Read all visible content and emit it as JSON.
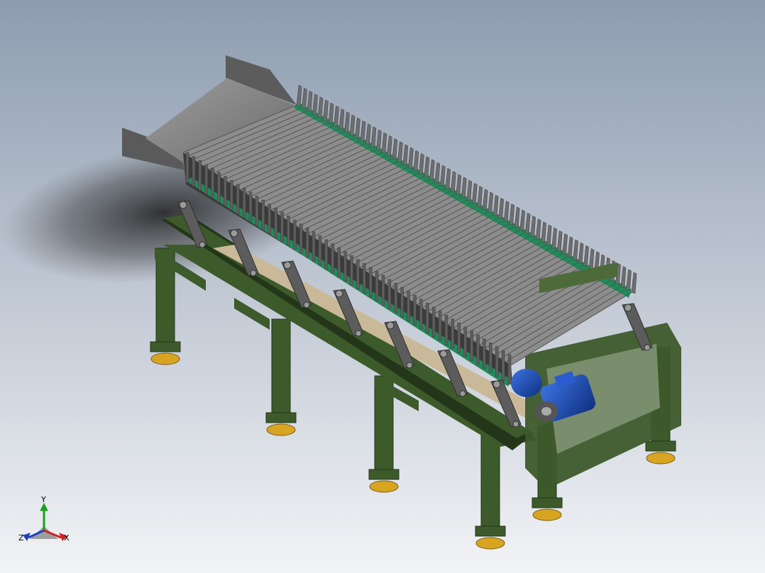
{
  "viewport": {
    "background_top": "#8d9cb0",
    "background_bottom": "#f2f3f6"
  },
  "model": {
    "frame_color": "#3d5a2b",
    "frame_dark": "#24361a",
    "chute_color": "#8a8a8a",
    "fin_color": "#6e6e6e",
    "belt_color": "#1e8c5a",
    "motor_color": "#1f4fb8",
    "foot_color": "#d9a521",
    "rail_color": "#c9b998"
  },
  "triad": {
    "x_label": "X",
    "y_label": "Y",
    "z_label": "Z",
    "x_color": "#d02020",
    "y_color": "#1aa01a",
    "z_color": "#2040c0"
  }
}
